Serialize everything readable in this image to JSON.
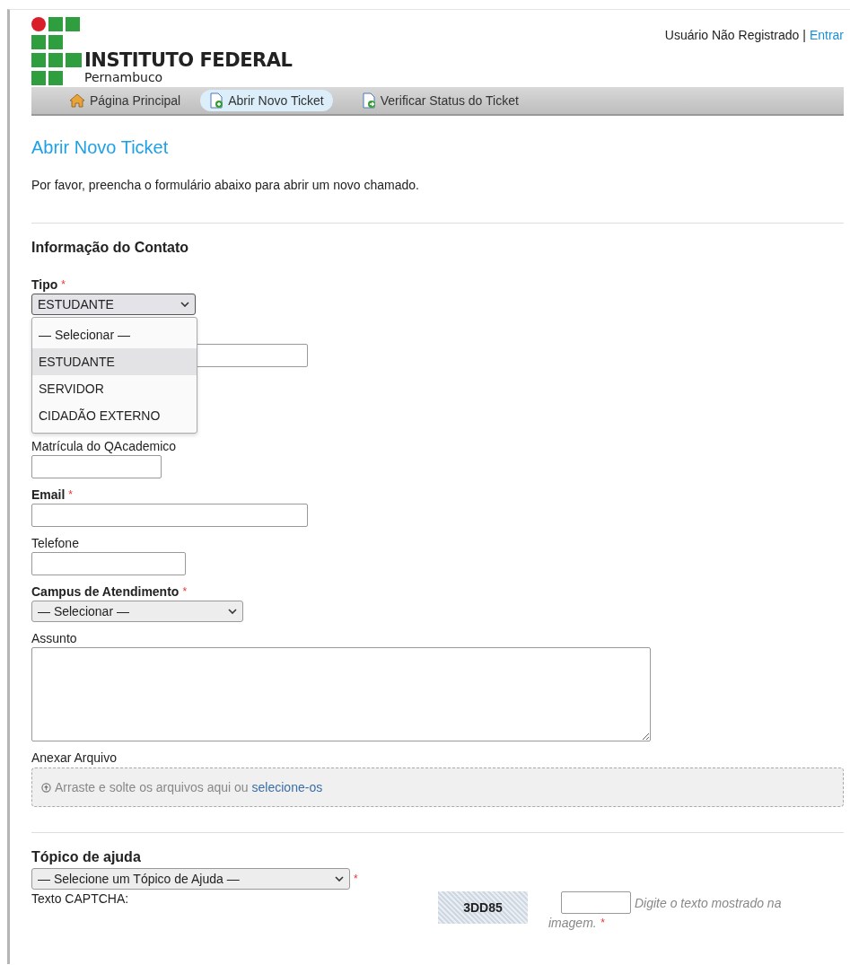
{
  "header": {
    "logo_name": "INSTITUTO FEDERAL",
    "logo_sub": "Pernambuco",
    "user_status": "Usuário Não Registrado",
    "separator": "|",
    "login_link": "Entrar"
  },
  "nav": [
    {
      "kind": "home",
      "label": "Página Principal",
      "selected": false
    },
    {
      "kind": "new",
      "label": "Abrir Novo Ticket",
      "selected": true
    },
    {
      "kind": "status",
      "label": "Verificar Status do Ticket",
      "selected": false
    }
  ],
  "title": "Abrir Novo Ticket",
  "intro": "Por favor, preencha o formulário abaixo para abrir um novo chamado.",
  "contact": {
    "heading": "Informação do Contato",
    "fields": [
      {
        "kind": "select",
        "label": "Tipo",
        "required_mark": "*",
        "value": "ESTUDANTE",
        "expanded": true,
        "options": [
          {
            "label": "— Selecionar —",
            "selected": false
          },
          {
            "label": "ESTUDANTE",
            "selected": true
          },
          {
            "label": "SERVIDOR",
            "selected": false
          },
          {
            "label": "CIDADÃO EXTERNO",
            "selected": false
          }
        ]
      },
      {
        "kind": "text"
      },
      {
        "kind": "text",
        "label": "Matrícula do QAcademico"
      },
      {
        "kind": "text",
        "label": "Email",
        "required_mark": "*"
      },
      {
        "kind": "text",
        "label": "Telefone"
      },
      {
        "kind": "select",
        "label": "Campus de Atendimento",
        "required_mark": "*",
        "value": "— Selecionar —"
      },
      {
        "kind": "textarea",
        "label": "Assunto"
      },
      {
        "kind": "dropzone",
        "label": "Anexar Arquivo",
        "text": "Arraste e solte os arquivos aqui ou",
        "link": "selecione-os"
      }
    ]
  },
  "help": {
    "heading": "Tópico de ajuda",
    "select": {
      "value": "— Selecione um Tópico de Ajuda —",
      "required_mark": "*"
    },
    "captcha": {
      "label": "Texto CAPTCHA:",
      "code": "3DD85",
      "hint_lines": [
        "Digite o texto mostrado na",
        "imagem."
      ],
      "required_mark": "*"
    }
  }
}
